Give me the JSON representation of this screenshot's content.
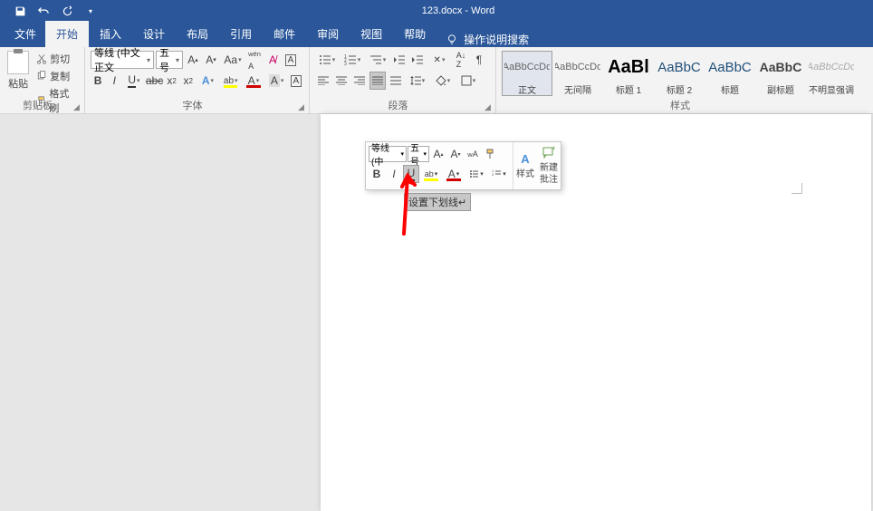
{
  "title": "123.docx  -  Word",
  "tabs": {
    "file": "文件",
    "home": "开始",
    "insert": "插入",
    "design": "设计",
    "layout": "布局",
    "references": "引用",
    "mailings": "邮件",
    "review": "审阅",
    "view": "视图",
    "help": "帮助",
    "tellme": "操作说明搜索"
  },
  "clipboard": {
    "paste": "粘贴",
    "cut": "剪切",
    "copy": "复制",
    "format_painter": "格式刷",
    "group": "剪贴板"
  },
  "font": {
    "name": "等线 (中文正文",
    "size": "五号",
    "group": "字体"
  },
  "paragraph": {
    "group": "段落"
  },
  "styles": {
    "group": "样式",
    "items": [
      {
        "preview": "AaBbCcDd",
        "name": "正文",
        "cls": "norm",
        "selected": true
      },
      {
        "preview": "AaBbCcDd",
        "name": "无间隔",
        "cls": "norm"
      },
      {
        "preview": "AaBl",
        "name": "标题 1",
        "cls": "big"
      },
      {
        "preview": "AaBbC",
        "name": "标题 2",
        "cls": "med"
      },
      {
        "preview": "AaBbC",
        "name": "标题",
        "cls": "med"
      },
      {
        "preview": "AaBbC",
        "name": "副标题",
        "cls": "sub"
      },
      {
        "preview": "AaBbCcDd",
        "name": "不明显强调",
        "cls": "grey"
      }
    ]
  },
  "mini": {
    "font": "等线 (中",
    "size": "五号",
    "style_btn": "样式",
    "comment_btn": "新建\n批注"
  },
  "tooltip": "设置下划线↵"
}
